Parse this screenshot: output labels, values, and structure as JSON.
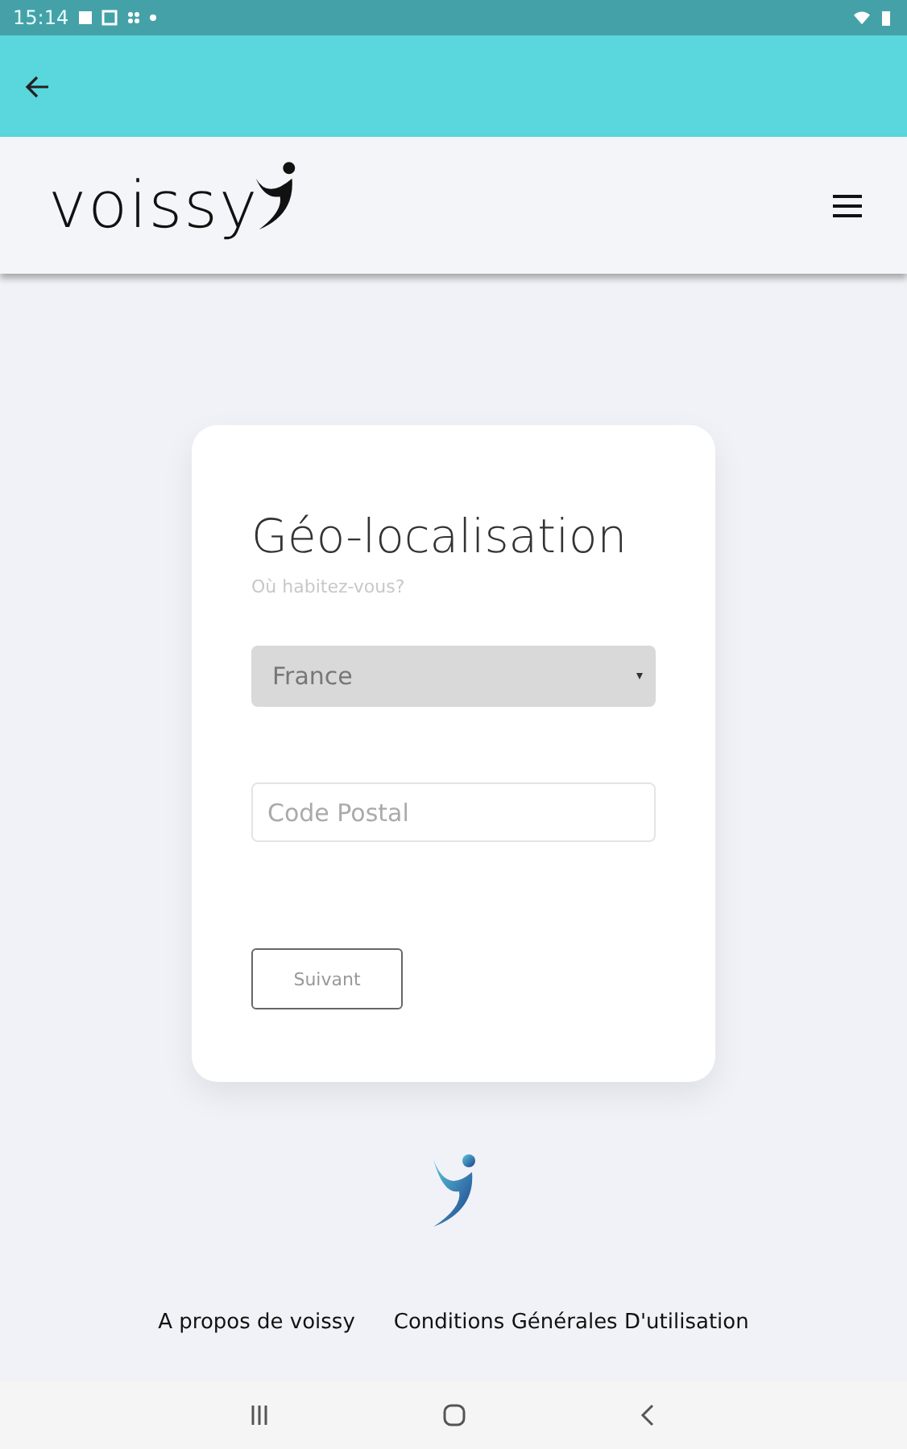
{
  "status_bar": {
    "time": "15:14"
  },
  "header": {
    "logo": "voissy"
  },
  "form": {
    "title": "Géo-localisation",
    "subtitle": "Où habitez-vous?",
    "country": {
      "value": "France"
    },
    "postal_code": {
      "placeholder": "Code Postal"
    },
    "button": "Suivant"
  },
  "footer": {
    "links": [
      "A propos de voissy",
      "Conditions Générales D'utilisation"
    ]
  }
}
